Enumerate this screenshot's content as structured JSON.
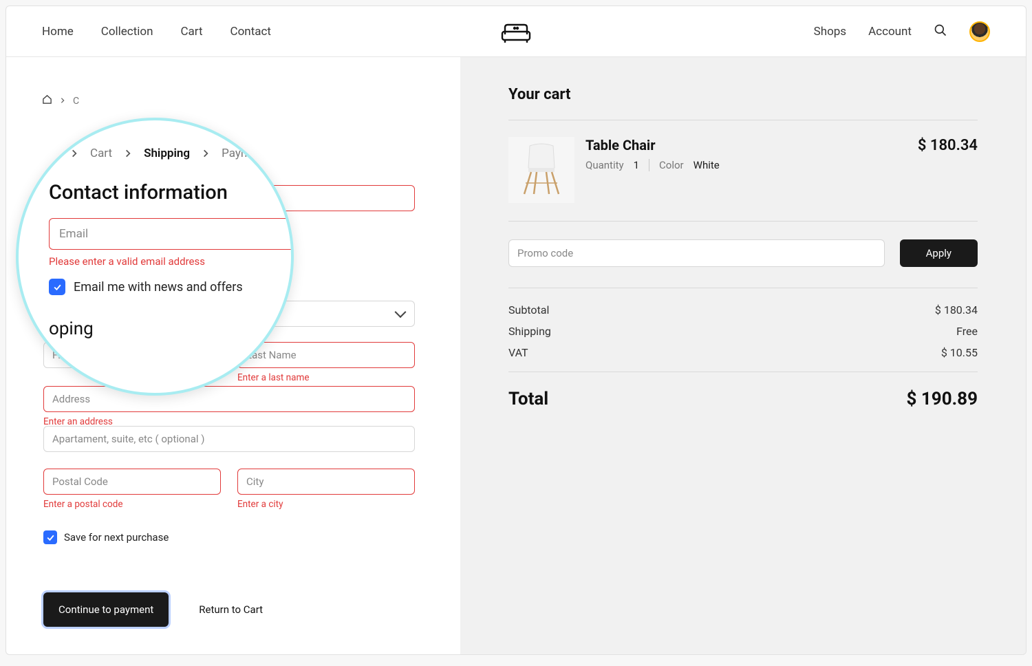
{
  "nav": {
    "left": [
      "Home",
      "Collection",
      "Cart",
      "Contact"
    ],
    "right": [
      "Shops",
      "Account"
    ]
  },
  "breadcrumb": {
    "cart": "Cart",
    "shipping": "Shipping",
    "payment": "Payment"
  },
  "crumb_small_first": "C",
  "contact": {
    "heading": "Contact information",
    "email_placeholder": "Email",
    "email_error": "Please enter a valid email address",
    "news_label": "Email me with news and offers"
  },
  "shipping_word_fragment": "oping",
  "form": {
    "first_name_placeholder": "First name",
    "last_name_placeholder": "Last Name",
    "last_name_error": "Enter a last name",
    "address_placeholder": "Address",
    "address_error": "Enter an address",
    "apt_placeholder": "Apartament, suite, etc ( optional )",
    "postal_placeholder": "Postal Code",
    "postal_error": "Enter a postal code",
    "city_placeholder": "City",
    "city_error": "Enter a city",
    "save_label": "Save for next purchase"
  },
  "actions": {
    "continue": "Continue to payment",
    "return": "Return to Cart"
  },
  "cart": {
    "title": "Your cart",
    "item": {
      "name": "Table Chair",
      "qty_label": "Quantity",
      "qty_value": "1",
      "color_label": "Color",
      "color_value": "White",
      "price": "$ 180.34"
    },
    "promo_placeholder": "Promo code",
    "apply": "Apply",
    "subtotal_label": "Subtotal",
    "subtotal_value": "$  180.34",
    "shipping_label": "Shipping",
    "shipping_value": "Free",
    "vat_label": "VAT",
    "vat_value": "$ 10.55",
    "total_label": "Total",
    "total_value": "$ 190.89"
  }
}
